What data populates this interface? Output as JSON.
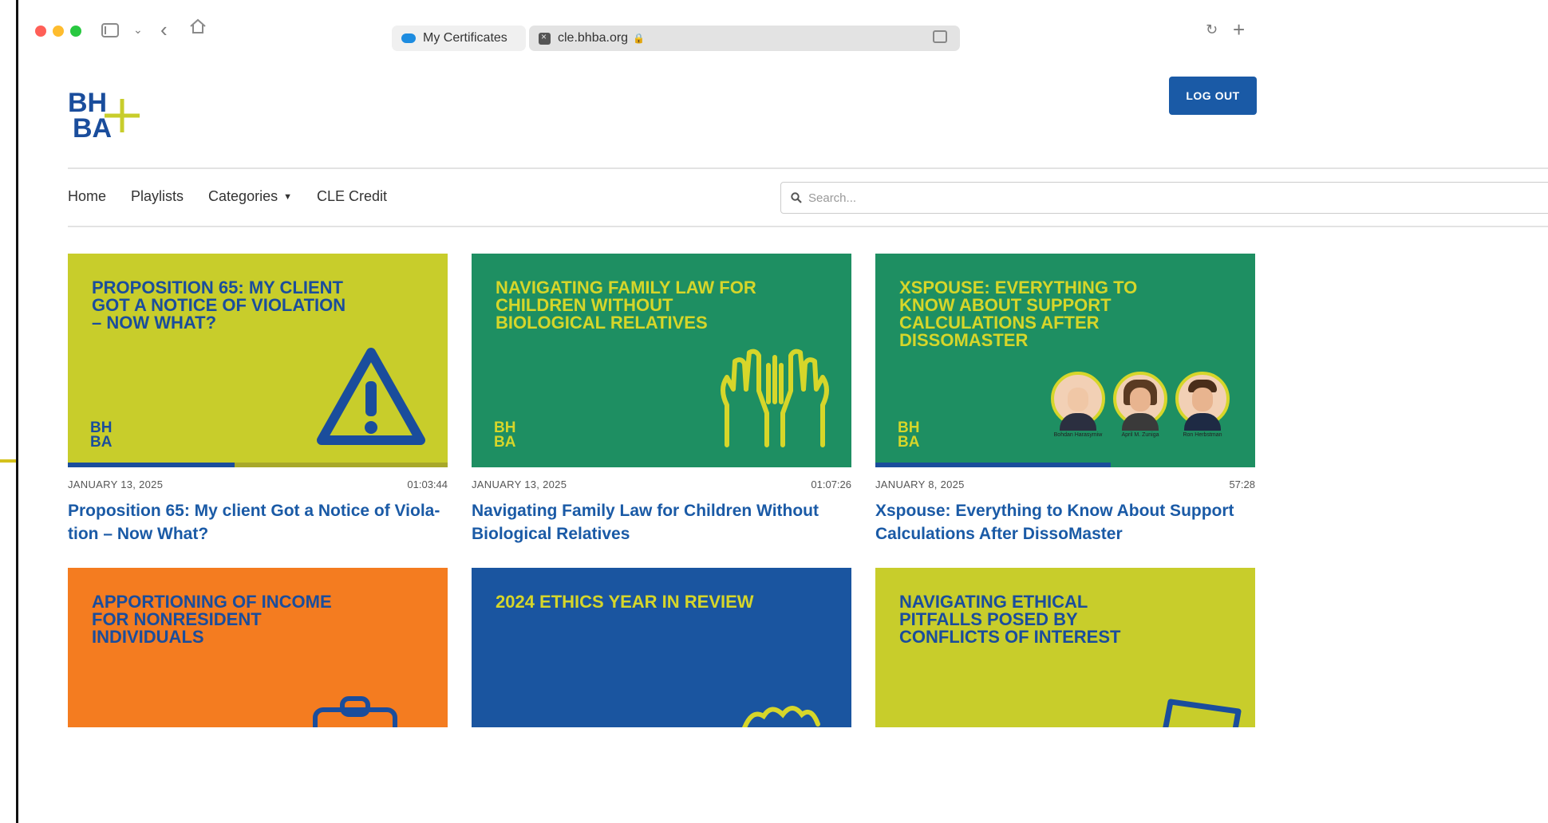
{
  "browser": {
    "tab_label": "My Certificates",
    "url": "cle.bhba.org"
  },
  "site": {
    "logo_text_top": "BH",
    "logo_text_bottom": "BA",
    "logout_label": "LOG OUT",
    "nav": [
      "Home",
      "Playlists",
      "Categories",
      "CLE Credit"
    ],
    "search_placeholder": "Search..."
  },
  "videos": [
    {
      "thumb_title": "PROPOSITION 65: MY CLIENT GOT A NOTICE OF VIOLATION – NOW WHAT?",
      "date": "JANUARY 13, 2025",
      "duration": "01:03:44",
      "title": "Proposition 65: My client Got a Notice of Viola-tion – Now What?",
      "thumb_color": "#c8cd2b",
      "thumb_text_color": "#1a4d9c",
      "icon": "warning-icon",
      "progress": 0.44
    },
    {
      "thumb_title": "NAVIGATING FAMILY LAW FOR CHILDREN WITHOUT BIOLOGICAL RELATIVES",
      "date": "JANUARY 13, 2025",
      "duration": "01:07:26",
      "title": "Navigating Family Law for Children Without Biological Relatives",
      "thumb_color": "#1e8f62",
      "thumb_text_color": "#d6d62a",
      "icon": "hands-icon",
      "progress": 0
    },
    {
      "thumb_title": "XSPOUSE: EVERYTHING TO KNOW ABOUT SUPPORT CALCULATIONS AFTER DISSOMASTER",
      "date": "JANUARY 8, 2025",
      "duration": "57:28",
      "title": "Xspouse: Everything to Know About Support Calculations After DissoMaster",
      "thumb_color": "#1e8f62",
      "thumb_text_color": "#d6d62a",
      "icon": "speakers",
      "progress": 0.62,
      "speakers": [
        "Bohdan Harasymiw",
        "April M. Zuniga",
        "Ron Herbstman"
      ]
    },
    {
      "thumb_title": "APPORTIONING OF INCOME FOR NONRESIDENT INDIVIDUALS",
      "thumb_color": "#f47c20",
      "thumb_text_color": "#1a4d9c",
      "icon": "clipboard-icon"
    },
    {
      "thumb_title": "2024 ETHICS YEAR IN REVIEW",
      "thumb_color": "#1a55a0",
      "thumb_text_color": "#d6d62a",
      "icon": "hands-icon"
    },
    {
      "thumb_title": "NAVIGATING ETHICAL PITFALLS POSED BY CONFLICTS OF INTEREST",
      "thumb_color": "#c8cd2b",
      "thumb_text_color": "#1a4d9c",
      "icon": "document-icon"
    }
  ]
}
